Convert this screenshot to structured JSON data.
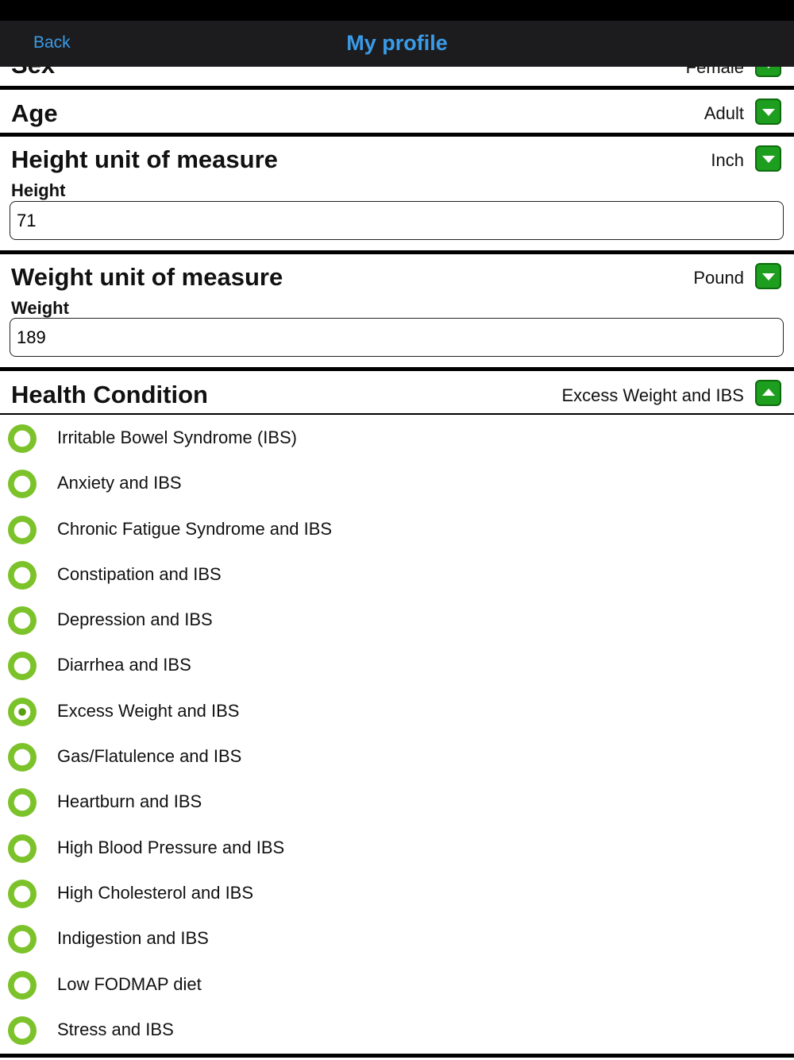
{
  "nav": {
    "back_label": "Back",
    "title": "My profile"
  },
  "sex": {
    "label": "Sex",
    "value": "Female"
  },
  "age": {
    "label": "Age",
    "value": "Adult"
  },
  "height": {
    "unit_label": "Height unit of measure",
    "unit_value": "Inch",
    "field_label": "Height",
    "field_value": "71"
  },
  "weight": {
    "unit_label": "Weight unit of measure",
    "unit_value": "Pound",
    "field_label": "Weight",
    "field_value": "189"
  },
  "health": {
    "label": "Health Condition",
    "value": "Excess Weight and IBS",
    "options": [
      {
        "label": "Irritable Bowel Syndrome (IBS)",
        "selected": false
      },
      {
        "label": "Anxiety and IBS",
        "selected": false
      },
      {
        "label": "Chronic Fatigue Syndrome and IBS",
        "selected": false
      },
      {
        "label": "Constipation and IBS",
        "selected": false
      },
      {
        "label": "Depression and IBS",
        "selected": false
      },
      {
        "label": "Diarrhea and IBS",
        "selected": false
      },
      {
        "label": "Excess Weight and IBS",
        "selected": true
      },
      {
        "label": "Gas/Flatulence and IBS",
        "selected": false
      },
      {
        "label": "Heartburn and IBS",
        "selected": false
      },
      {
        "label": "High Blood Pressure and IBS",
        "selected": false
      },
      {
        "label": "High Cholesterol and IBS",
        "selected": false
      },
      {
        "label": "Indigestion and IBS",
        "selected": false
      },
      {
        "label": "Low FODMAP diet",
        "selected": false
      },
      {
        "label": "Stress and IBS",
        "selected": false
      }
    ]
  },
  "colors": {
    "accent": "#3a9be8",
    "button_green": "#1e9e1e",
    "radio_green": "#7cc22a"
  }
}
